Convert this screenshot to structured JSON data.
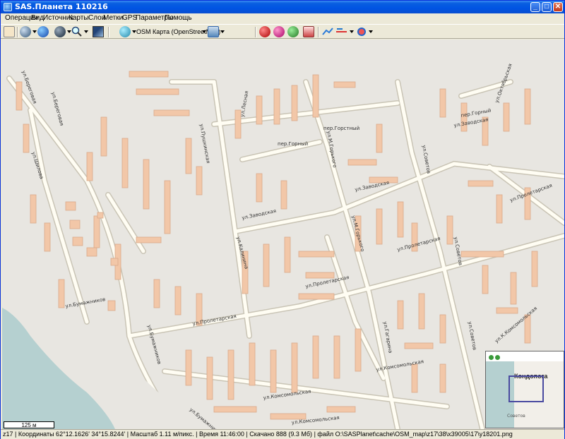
{
  "window": {
    "title": "SAS.Планета 110216",
    "minimize": "_",
    "maximize": "□",
    "close": "✕"
  },
  "menu": {
    "items": [
      "Операции",
      "Вид",
      "Источник",
      "Карты",
      "Слои",
      "Метки",
      "GPS",
      "Параметры",
      "Помощь"
    ]
  },
  "toolbar": {
    "map_selector": "OSM Карта (OpenStreetMap)",
    "icons": [
      "hand-icon",
      "globe-settings-icon",
      "earth-icon",
      "zoom-icon",
      "image-icon",
      "map-source-icon",
      "layers-icon",
      "mark-add-icon",
      "mark-edit-icon",
      "mark-delete-icon",
      "mark-export-icon",
      "gps-track-icon",
      "gps-route-icon",
      "gps-settings-icon"
    ]
  },
  "map": {
    "street_labels": [
      "пер.Горный",
      "пер.Горстный",
      "ул.Заводская",
      "ул.Заводская",
      "ул.Пролетарская",
      "ул.Пролетарская",
      "ул.Пролетарская",
      "ул.Бумажников",
      "ул.Бумажников",
      "ул.Комсомольская",
      "ул.Комсомольская",
      "ул.М.Горького",
      "ул.М.Горького",
      "ул.Советов",
      "ул.Советов",
      "ул.Калинина",
      "ул.Пушкинская",
      "ул.Лесная",
      "ул.Береговая",
      "ул.К.Комсомольская",
      "ул.Октябрьская",
      "ул.Заводская",
      "пер.Горный",
      "ул.Советов",
      "ул.Пролетарская",
      "ул.Шилова",
      "ул.Береговая",
      "ул.Гагарина",
      "ул.Бумажников",
      "ул.Комсомольская"
    ],
    "water_color": "#b5d0d0",
    "building_color": "#f2c7a8",
    "road_color": "#fffdf3"
  },
  "scale": {
    "label": "125 м"
  },
  "minimap": {
    "city_label": "Кондопога",
    "street_label": "Советов"
  },
  "status": {
    "zoom": "z17",
    "coords": "Координаты 62°12.1626' 34°15.8244'",
    "scale": "Масштаб 1.11 м/пикс.",
    "time": "Время 11:46:00",
    "downloaded": "Скачано 888 (9.3 Мб)",
    "file": "файл O:\\SASPlanet\\cache\\OSM_map\\z17\\38\\x39005\\17\\y18201.png"
  }
}
